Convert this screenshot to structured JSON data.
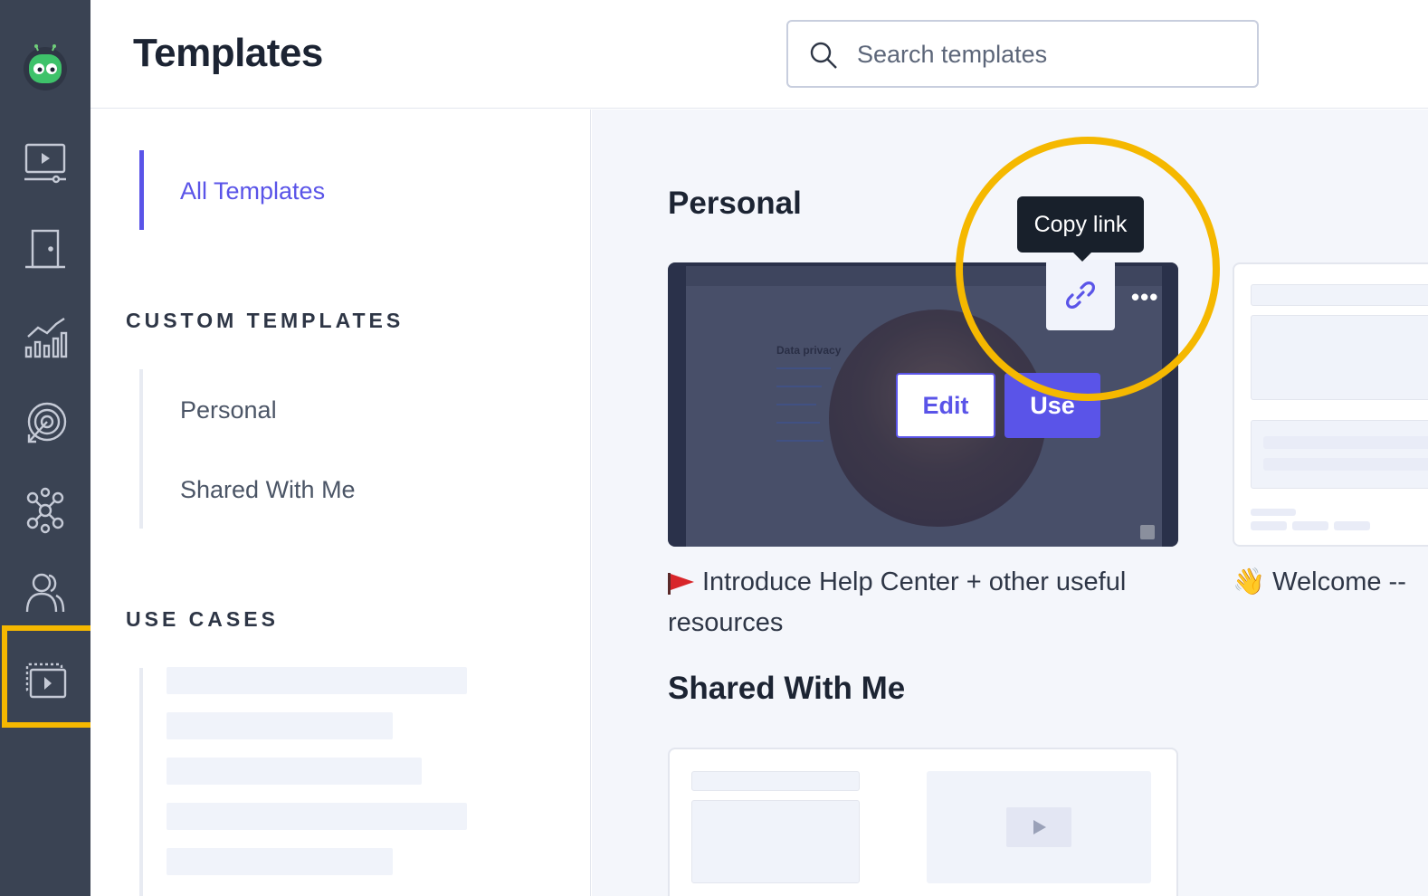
{
  "app": {
    "page_title": "Templates"
  },
  "search": {
    "placeholder": "Search templates",
    "value": ""
  },
  "rail": {
    "items": [
      {
        "icon": "robot-logo-icon"
      },
      {
        "icon": "video-screen-icon"
      },
      {
        "icon": "door-icon"
      },
      {
        "icon": "analytics-chart-icon"
      },
      {
        "icon": "target-icon"
      },
      {
        "icon": "network-hub-icon"
      },
      {
        "icon": "people-icon"
      },
      {
        "icon": "video-templates-icon",
        "highlighted": true
      }
    ],
    "highlight_color": "#f5b800"
  },
  "sidenav": {
    "all_templates": "All Templates",
    "custom_heading": "CUSTOM TEMPLATES",
    "custom_items": [
      "Personal",
      "Shared With Me"
    ],
    "use_cases_heading": "USE CASES"
  },
  "main": {
    "personal_heading": "Personal",
    "shared_heading": "Shared With Me",
    "cards": [
      {
        "title": "Introduce Help Center + other useful resources",
        "emoji": "flag-icon",
        "edit_label": "Edit",
        "use_label": "Use",
        "more_label": "•••",
        "tooltip": "Copy link",
        "thumb_doc_title": "Data privacy"
      },
      {
        "title": "Welcome --",
        "emoji": "👋"
      }
    ]
  },
  "colors": {
    "accent": "#5a54e8",
    "rail_bg": "#3a4353",
    "annotation": "#f5b800",
    "tooltip_bg": "#18202b"
  }
}
